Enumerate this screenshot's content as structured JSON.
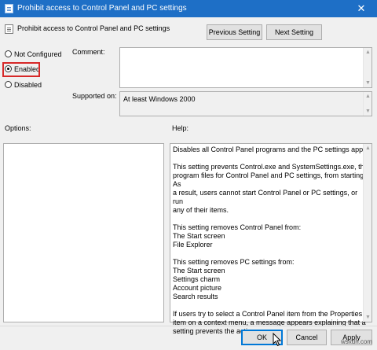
{
  "window": {
    "title": "Prohibit access to Control Panel and PC settings",
    "close_glyph": "✕"
  },
  "header": {
    "title": "Prohibit access to Control Panel and PC settings"
  },
  "nav": {
    "previous": "Previous Setting",
    "next": "Next Setting"
  },
  "state": {
    "options": [
      {
        "label": "Not Configured",
        "checked": false
      },
      {
        "label": "Enabled",
        "checked": true
      },
      {
        "label": "Disabled",
        "checked": false
      }
    ]
  },
  "comment": {
    "label": "Comment:",
    "value": ""
  },
  "supported": {
    "label": "Supported on:",
    "value": "At least Windows 2000"
  },
  "options_section": {
    "label": "Options:"
  },
  "help_section": {
    "label": "Help:",
    "paragraphs": [
      "Disables all Control Panel programs and the PC settings app.",
      "This setting prevents Control.exe and SystemSettings.exe, the\nprogram files for Control Panel and PC settings, from starting. As\na result, users cannot start Control Panel or PC settings, or run\nany of their items.",
      "This setting removes Control Panel from:\nThe Start screen\nFile Explorer",
      "This setting removes PC settings from:\nThe Start screen\nSettings charm\nAccount picture\nSearch results",
      "If users try to select a Control Panel item from the Properties\nitem on a context menu, a message appears explaining that a\nsetting prevents the action."
    ]
  },
  "footer": {
    "ok": "OK",
    "cancel": "Cancel",
    "apply": "Apply"
  },
  "watermark": "wsxdn.com",
  "icons": {
    "app": "policy-setting-icon",
    "cursor": "mouse-pointer-icon"
  }
}
